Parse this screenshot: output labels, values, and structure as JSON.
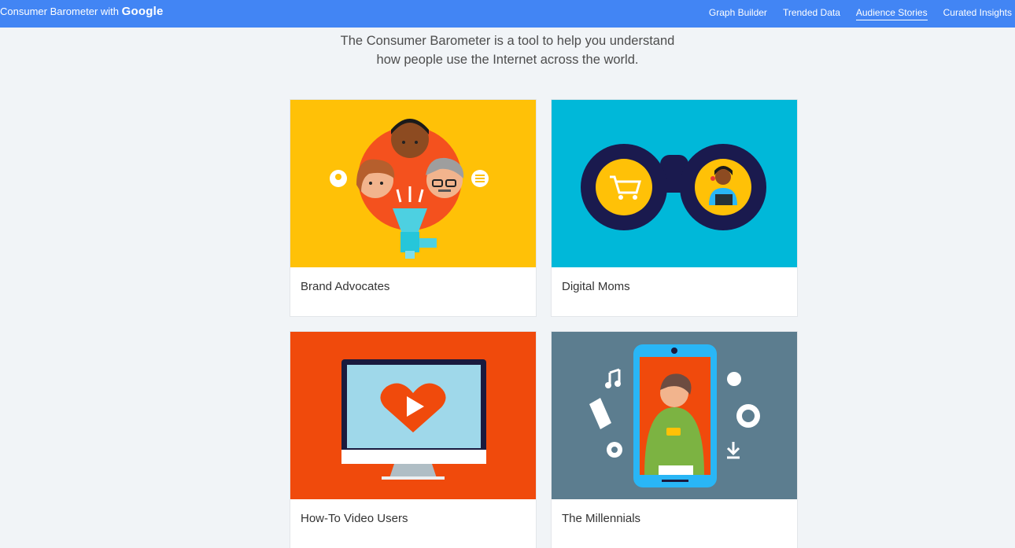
{
  "header": {
    "brand_prefix": "Consumer Barometer with",
    "brand_google": "Google",
    "nav": [
      {
        "label": "Graph Builder"
      },
      {
        "label": "Trended Data"
      },
      {
        "label": "Audience Stories",
        "active": true
      },
      {
        "label": "Curated Insights"
      }
    ]
  },
  "intro": {
    "line1": "The Consumer Barometer is a tool to help you understand",
    "line2": "how people use the Internet across the world."
  },
  "cards": [
    {
      "title": "Brand Advocates",
      "bg": "#ffc107"
    },
    {
      "title": "Digital Moms",
      "bg": "#00b8d9"
    },
    {
      "title": "How-To Video Users",
      "bg": "#f04a0c"
    },
    {
      "title": "The Millennials",
      "bg": "#5c7d8f"
    }
  ],
  "colors": {
    "topbar": "#4285f4",
    "page_bg": "#f1f4f7"
  }
}
